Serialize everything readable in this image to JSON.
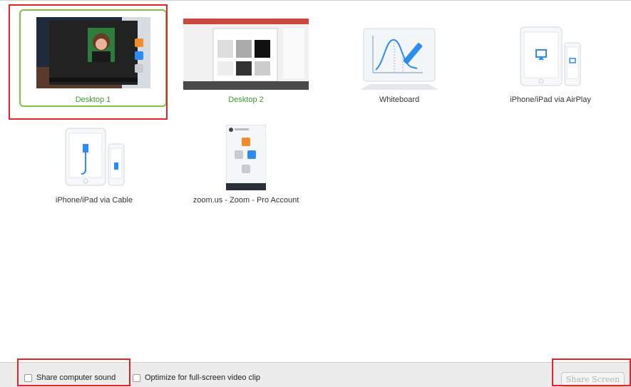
{
  "sources": [
    {
      "label": "Desktop 1",
      "icon": "desktop-thumbnail-icon"
    },
    {
      "label": "Desktop 2",
      "icon": "desktop-thumbnail-icon"
    },
    {
      "label": "Whiteboard",
      "icon": "whiteboard-icon"
    },
    {
      "label": "iPhone/iPad via AirPlay",
      "icon": "airplay-devices-icon"
    },
    {
      "label": "iPhone/iPad via Cable",
      "icon": "cable-devices-icon"
    },
    {
      "label": "zoom.us - Zoom - Pro Account",
      "icon": "zoom-window-icon"
    }
  ],
  "bottom": {
    "share_sound_label": "Share computer sound",
    "optimize_label": "Optimize for full-screen video clip",
    "share_button": "Share Screen"
  },
  "colors": {
    "selected_border": "#7dc24b",
    "selected_label": "#3c9a29",
    "highlight_box": "#e0242a",
    "accent_blue": "#2d8cf0",
    "zoom_orange": "#f28b2b"
  }
}
